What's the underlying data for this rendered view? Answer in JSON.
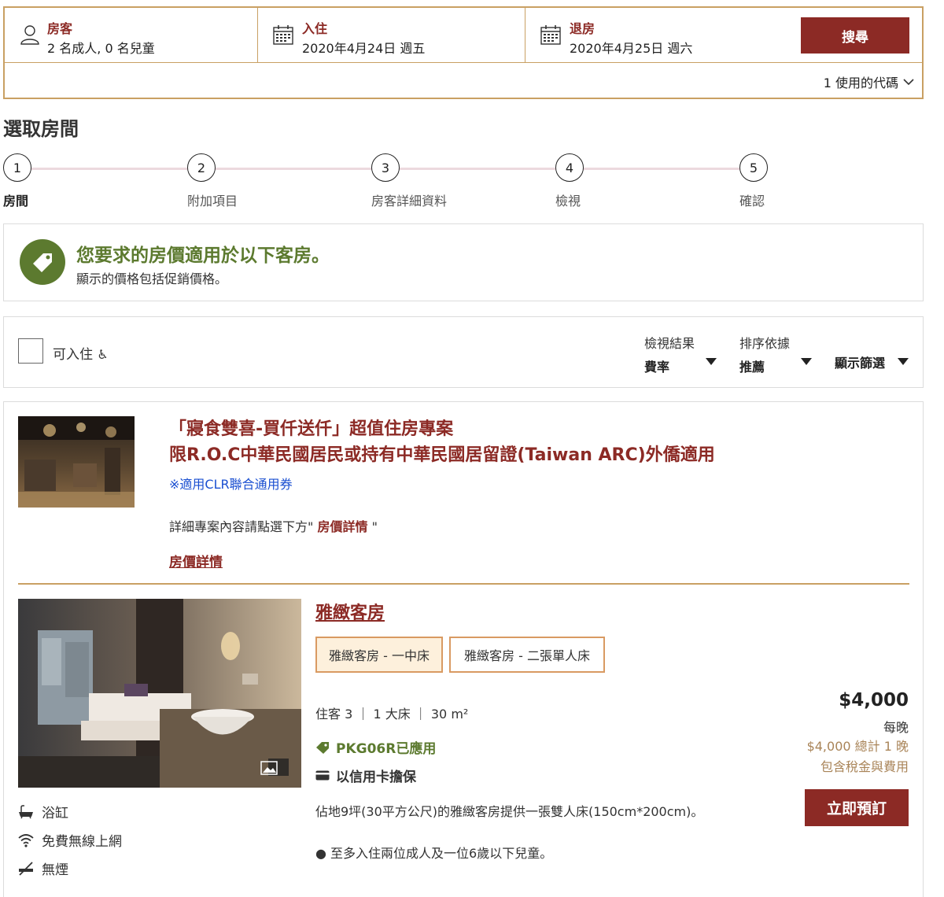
{
  "search": {
    "guests_label": "房客",
    "guests_value": "2 名成人, 0 名兒童",
    "checkin_label": "入住",
    "checkin_value": "2020年4月24日 週五",
    "checkout_label": "退房",
    "checkout_value": "2020年4月25日 週六",
    "search_button": "搜尋",
    "promo_code": "1 使用的代碼"
  },
  "page_title": "選取房間",
  "steps": [
    {
      "number": "1",
      "label": "房間"
    },
    {
      "number": "2",
      "label": "附加項目"
    },
    {
      "number": "3",
      "label": "房客詳細資料"
    },
    {
      "number": "4",
      "label": "檢視"
    },
    {
      "number": "5",
      "label": "確認"
    }
  ],
  "notice": {
    "title": "您要求的房價適用於以下客房。",
    "subtitle": "顯示的價格包括促銷價格。"
  },
  "filter": {
    "accessible_label": "可入住",
    "view_results_label": "檢視結果",
    "view_results_value": "費率",
    "sort_label": "排序依據",
    "sort_value": "推薦",
    "show_filters": "顯示篩選"
  },
  "package": {
    "title_line1": "「寢食雙喜-買仟送仟」超值住房專案",
    "title_line2": "限R.O.C中華民國居民或持有中華民國居留證(Taiwan ARC)外僑適用",
    "clr_note": "※適用CLR聯合通用券",
    "detail_prefix": "詳細專案內容請點選下方\"",
    "detail_link": "房價詳情",
    "detail_suffix": "\"",
    "rate_details_link": "房價詳情"
  },
  "room": {
    "name": "雅緻客房",
    "bed_types": [
      {
        "label": "雅緻客房 - 一中床",
        "selected": true
      },
      {
        "label": "雅緻客房 - 二張單人床",
        "selected": false
      }
    ],
    "meta": "住客 3 ｜ 1 大床 ｜ 30 m²",
    "package_applied": "PKG06R已應用",
    "guarantee": "以信用卡擔保",
    "description": "佔地9坪(30平方公尺)的雅緻客房提供一張雙人床(150cm*200cm)。",
    "bullet": "● 至多入住兩位成人及一位6歲以下兒童。",
    "price": "$4,000",
    "per_night": "每晚",
    "total": "$4,000 總計 1 晚",
    "tax_note": "包含稅金與費用",
    "book_button": "立即預訂",
    "amenities": [
      {
        "icon": "bathtub-icon",
        "label": "浴缸"
      },
      {
        "icon": "wifi-icon",
        "label": "免費無線上網"
      },
      {
        "icon": "no-smoking-icon",
        "label": "無煙"
      }
    ]
  },
  "colors": {
    "brand": "#8c2a25",
    "gold": "#c9a063",
    "green": "#5c7a2f",
    "link_blue": "#1a4fd1"
  }
}
